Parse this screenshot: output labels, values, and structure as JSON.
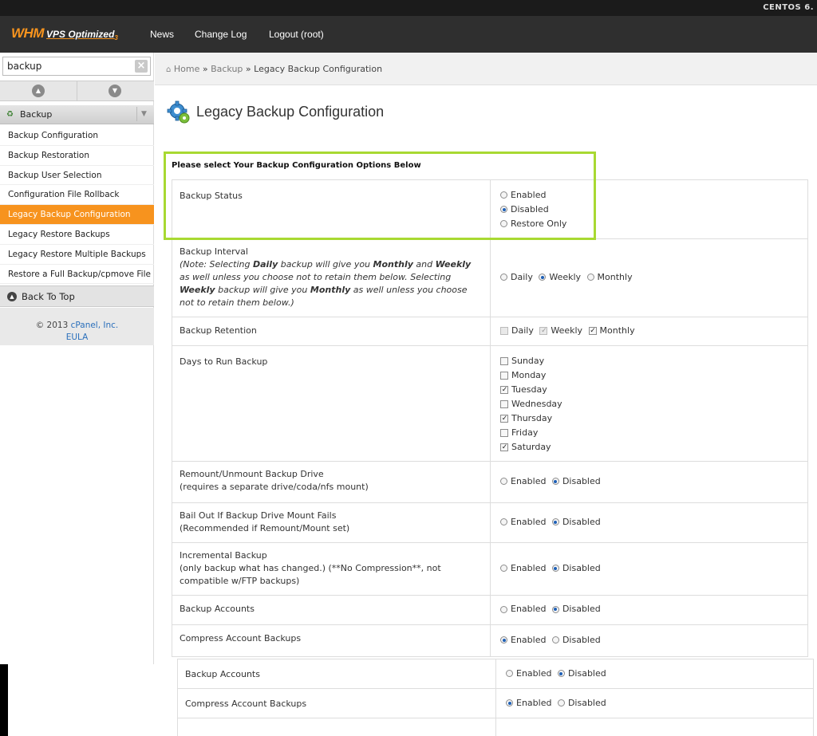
{
  "top_strip": {
    "os_label": "CENTOS 6."
  },
  "header": {
    "logo_whm": "WHM",
    "logo_vps": "VPS Optimized",
    "logo_sub": "3",
    "nav": [
      "News",
      "Change Log",
      "Logout (root)"
    ]
  },
  "sidebar": {
    "search_value": "backup",
    "category": "Backup",
    "items": [
      "Backup Configuration",
      "Backup Restoration",
      "Backup User Selection",
      "Configuration File Rollback",
      "Legacy Backup Configuration",
      "Legacy Restore Backups",
      "Legacy Restore Multiple Backups",
      "Restore a Full Backup/cpmove File"
    ],
    "active_index": 4,
    "back_to_top": "Back To Top",
    "copyright_prefix": "© 2013",
    "copyright_link": "cPanel, Inc.",
    "eula": "EULA"
  },
  "breadcrumb": {
    "home": "Home",
    "sep": "»",
    "section": "Backup",
    "current": "Legacy Backup Configuration"
  },
  "page": {
    "title": "Legacy Backup Configuration",
    "section_heading": "Please select Your Backup Configuration Options Below"
  },
  "settings": {
    "backup_status": {
      "label": "Backup Status",
      "options": [
        "Enabled",
        "Disabled",
        "Restore Only"
      ],
      "selected": "Disabled"
    },
    "backup_interval": {
      "label": "Backup Interval",
      "note_parts": [
        "(Note: Selecting ",
        "Daily",
        " backup will give you ",
        "Monthly",
        " and ",
        "Weekly",
        " as well unless you choose not to retain them below. Selecting ",
        "Weekly",
        " backup will give you ",
        "Monthly",
        " as well unless you choose not to retain them below.)"
      ],
      "options": [
        "Daily",
        "Weekly",
        "Monthly"
      ],
      "selected": "Weekly"
    },
    "backup_retention": {
      "label": "Backup Retention",
      "options": [
        "Daily",
        "Weekly",
        "Monthly"
      ],
      "checked": [
        "Weekly",
        "Monthly"
      ],
      "disabled": [
        "Daily",
        "Weekly"
      ]
    },
    "days_to_run": {
      "label": "Days to Run Backup",
      "days": [
        "Sunday",
        "Monday",
        "Tuesday",
        "Wednesday",
        "Thursday",
        "Friday",
        "Saturday"
      ],
      "checked": [
        "Tuesday",
        "Thursday",
        "Saturday"
      ]
    },
    "remount": {
      "label": "Remount/Unmount Backup Drive",
      "sub": "(requires a separate drive/coda/nfs mount)",
      "options": [
        "Enabled",
        "Disabled"
      ],
      "selected": "Disabled"
    },
    "bail_out": {
      "label": "Bail Out If Backup Drive Mount Fails",
      "sub": "(Recommended if Remount/Mount set)",
      "options": [
        "Enabled",
        "Disabled"
      ],
      "selected": "Disabled"
    },
    "incremental": {
      "label": "Incremental Backup",
      "sub": "(only backup what has changed.) (**No Compression**, not compatible w/FTP backups)",
      "options": [
        "Enabled",
        "Disabled"
      ],
      "selected": "Disabled"
    },
    "backup_accounts": {
      "label": "Backup Accounts",
      "options": [
        "Enabled",
        "Disabled"
      ],
      "selected": "Disabled"
    },
    "compress_accounts": {
      "label": "Compress Account Backups",
      "options": [
        "Enabled",
        "Disabled"
      ],
      "selected": "Enabled"
    }
  },
  "overlay_rows": {
    "backup_accounts": {
      "label": "Backup Accounts",
      "options": [
        "Enabled",
        "Disabled"
      ],
      "selected": "Disabled"
    },
    "compress_accounts": {
      "label": "Compress Account Backups",
      "options": [
        "Enabled",
        "Disabled"
      ],
      "selected": "Enabled"
    }
  },
  "colors": {
    "accent_orange": "#f7931e",
    "highlight_green": "#a8d932",
    "link_blue": "#2a6fbb"
  }
}
